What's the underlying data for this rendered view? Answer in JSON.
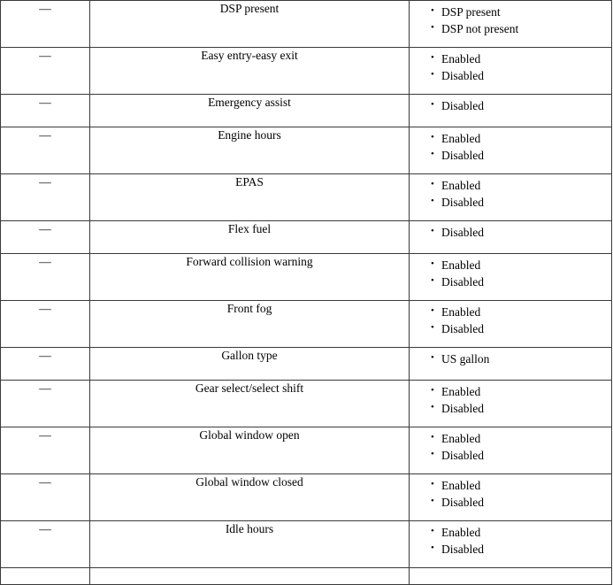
{
  "table": {
    "columns": [
      {
        "key": "dash",
        "header": ""
      },
      {
        "key": "name",
        "header": ""
      },
      {
        "key": "values",
        "header": ""
      }
    ],
    "dash_glyph": "—",
    "rows": [
      {
        "dash": "—",
        "name": "DSP present",
        "values": [
          "DSP present",
          "DSP not present"
        ]
      },
      {
        "dash": "—",
        "name": "Easy entry-easy exit",
        "values": [
          "Enabled",
          "Disabled"
        ]
      },
      {
        "dash": "—",
        "name": "Emergency assist",
        "values": [
          "Disabled"
        ]
      },
      {
        "dash": "—",
        "name": "Engine hours",
        "values": [
          "Enabled",
          "Disabled"
        ]
      },
      {
        "dash": "—",
        "name": "EPAS",
        "values": [
          "Enabled",
          "Disabled"
        ]
      },
      {
        "dash": "—",
        "name": "Flex fuel",
        "values": [
          "Disabled"
        ]
      },
      {
        "dash": "—",
        "name": "Forward collision warning",
        "values": [
          "Enabled",
          "Disabled"
        ]
      },
      {
        "dash": "—",
        "name": "Front fog",
        "values": [
          "Enabled",
          "Disabled"
        ]
      },
      {
        "dash": "—",
        "name": "Gallon type",
        "values": [
          "US gallon"
        ]
      },
      {
        "dash": "—",
        "name": "Gear select/select shift",
        "values": [
          "Enabled",
          "Disabled"
        ]
      },
      {
        "dash": "—",
        "name": "Global window open",
        "values": [
          "Enabled",
          "Disabled"
        ]
      },
      {
        "dash": "—",
        "name": "Global window closed",
        "values": [
          "Enabled",
          "Disabled"
        ]
      },
      {
        "dash": "—",
        "name": "Idle hours",
        "values": [
          "Enabled",
          "Disabled"
        ]
      },
      {
        "dash": "",
        "name": "",
        "values": []
      }
    ]
  },
  "style": {
    "border_color": "#3a3a3a",
    "text_color": "#000000",
    "background": "#ffffff"
  }
}
